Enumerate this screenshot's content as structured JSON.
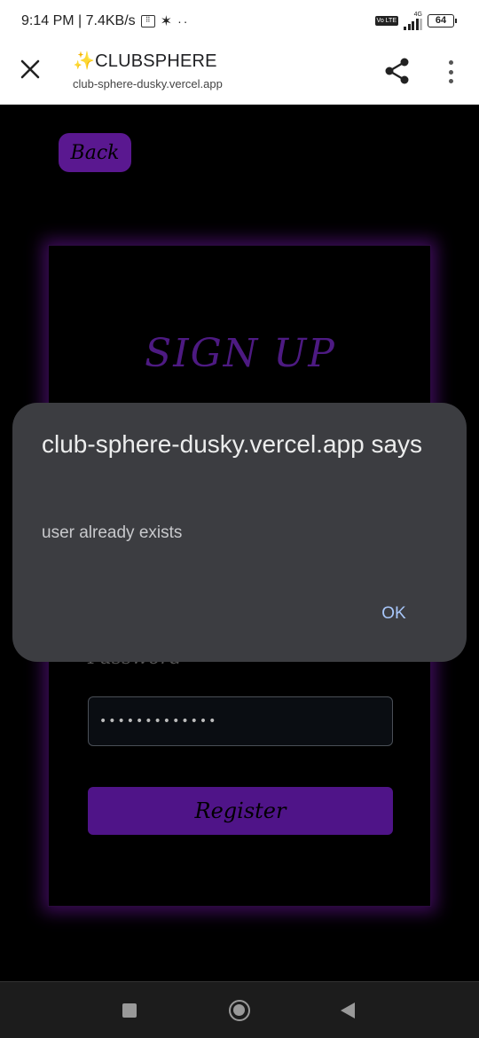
{
  "status_bar": {
    "time_speed": "9:14 PM | 7.4KB/s",
    "network_type": "4G",
    "volte": "Vo LTE",
    "battery": "64"
  },
  "browser": {
    "title": "✨CLUBSPHERE",
    "url": "club-sphere-dusky.vercel.app"
  },
  "page": {
    "back_label": "Back",
    "heading": "SIGN UP",
    "password_label": "Password",
    "password_value": "•••••••••••••",
    "register_label": "Register"
  },
  "dialog": {
    "title": "club-sphere-dusky.vercel.app says",
    "message": "user already exists",
    "ok_label": "OK"
  },
  "colors": {
    "accent": "#5a1890",
    "dialog_bg": "#3c3d41",
    "dialog_button": "#a8c7fa"
  },
  "icons": [
    "close-icon",
    "share-icon",
    "more-vert-icon",
    "recent-apps-icon",
    "home-icon",
    "back-icon"
  ]
}
